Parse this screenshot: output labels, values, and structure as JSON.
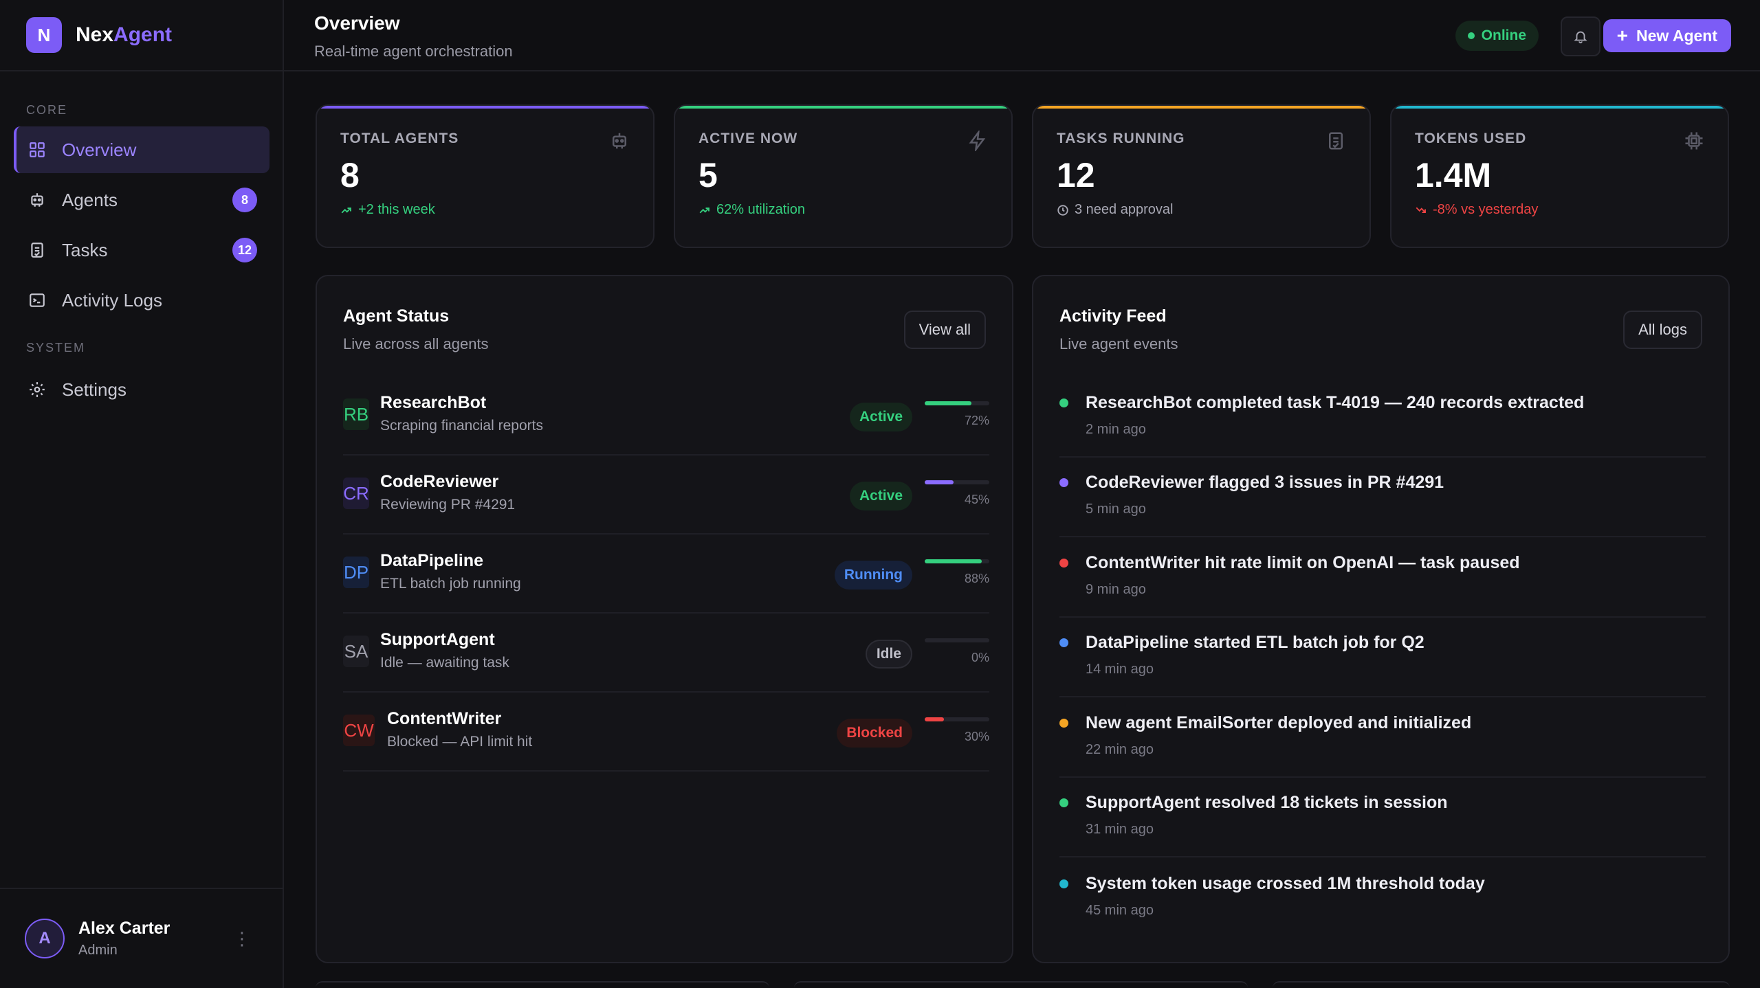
{
  "brand": {
    "initial": "N",
    "name_a": "Nex",
    "name_b": "Agent",
    "accent": "#7c5cf6"
  },
  "sidebar": {
    "sections": {
      "core": "CORE",
      "system": "SYSTEM"
    },
    "items": [
      {
        "label": "Overview",
        "icon": "grid-icon",
        "badge": ""
      },
      {
        "label": "Agents",
        "icon": "robot-icon",
        "badge": "8"
      },
      {
        "label": "Tasks",
        "icon": "clipboard-icon",
        "badge": "12"
      },
      {
        "label": "Activity Logs",
        "icon": "terminal-icon",
        "badge": ""
      },
      {
        "label": "Settings",
        "icon": "gear-icon",
        "badge": ""
      }
    ]
  },
  "user": {
    "initial": "A",
    "name": "Alex Carter",
    "role": "Admin",
    "menu": "⋮"
  },
  "header": {
    "title": "Overview",
    "subtitle": "Real-time agent orchestration",
    "status": "Online",
    "new_button": "New Agent"
  },
  "stats": [
    {
      "label": "TOTAL AGENTS",
      "value": "8",
      "delta": "+2 this week",
      "color": "#7c5cf6",
      "delta_color": "#35d07f",
      "icon": "robot-icon"
    },
    {
      "label": "ACTIVE NOW",
      "value": "5",
      "delta": "62% utilization",
      "color": "#35d07f",
      "delta_color": "#35d07f",
      "icon": "lightning-icon"
    },
    {
      "label": "TASKS RUNNING",
      "value": "12",
      "delta": "3 need approval",
      "color": "#f5a524",
      "delta_color": "#a8a8b4",
      "icon": "clipboard-icon"
    },
    {
      "label": "TOKENS USED",
      "value": "1.4M",
      "delta": "-8% vs yesterday",
      "color": "#22b8cf",
      "delta_color": "#ef4444",
      "icon": "chip-icon"
    }
  ],
  "agent_status": {
    "title": "Agent Status",
    "subtitle": "Live across all agents",
    "button": "View all",
    "agents": [
      {
        "initials": "RB",
        "name": "ResearchBot",
        "desc": "Scraping financial reports",
        "status": "Active",
        "pct": "72%",
        "progress": 0.72,
        "color": "#35d07f",
        "badge_bg": "#15261c",
        "badge_fg": "#35d07f",
        "init_bg": "#15261c"
      },
      {
        "initials": "CR",
        "name": "CodeReviewer",
        "desc": "Reviewing PR #4291",
        "status": "Active",
        "pct": "45%",
        "progress": 0.45,
        "color": "#8b6cff",
        "badge_bg": "#15261c",
        "badge_fg": "#35d07f",
        "init_bg": "#1f1b33"
      },
      {
        "initials": "DP",
        "name": "DataPipeline",
        "desc": "ETL batch job running",
        "status": "Running",
        "pct": "88%",
        "progress": 0.88,
        "color": "#35d07f",
        "badge_bg": "#162038",
        "badge_fg": "#4f8df5",
        "init_bg": "#162038"
      },
      {
        "initials": "SA",
        "name": "SupportAgent",
        "desc": "Idle — awaiting task",
        "status": "Idle",
        "pct": "0%",
        "progress": 0.0,
        "color": "#6e6e7a",
        "badge_bg": "#1c1c22",
        "badge_fg": "#c0c0ca",
        "init_bg": "#1c1c22"
      },
      {
        "initials": "CW",
        "name": "ContentWriter",
        "desc": "Blocked — API limit hit",
        "status": "Blocked",
        "pct": "30%",
        "progress": 0.3,
        "color": "#ef4444",
        "badge_bg": "#2a1515",
        "badge_fg": "#ef4444",
        "init_bg": "#2a1515"
      }
    ]
  },
  "activity": {
    "title": "Activity Feed",
    "subtitle": "Live agent events",
    "button": "All logs",
    "items": [
      {
        "text": "ResearchBot completed task T-4019 — 240 records extracted",
        "time": "2 min ago",
        "color": "#35d07f"
      },
      {
        "text": "CodeReviewer flagged 3 issues in PR #4291",
        "time": "5 min ago",
        "color": "#8b6cff"
      },
      {
        "text": "ContentWriter hit rate limit on OpenAI — task paused",
        "time": "9 min ago",
        "color": "#ef4444"
      },
      {
        "text": "DataPipeline started ETL batch job for Q2",
        "time": "14 min ago",
        "color": "#4f8df5"
      },
      {
        "text": "New agent EmailSorter deployed and initialized",
        "time": "22 min ago",
        "color": "#f5a524"
      },
      {
        "text": "SupportAgent resolved 18 tickets in session",
        "time": "31 min ago",
        "color": "#35d07f"
      },
      {
        "text": "System token usage crossed 1M threshold today",
        "time": "45 min ago",
        "color": "#22b8cf"
      }
    ]
  }
}
